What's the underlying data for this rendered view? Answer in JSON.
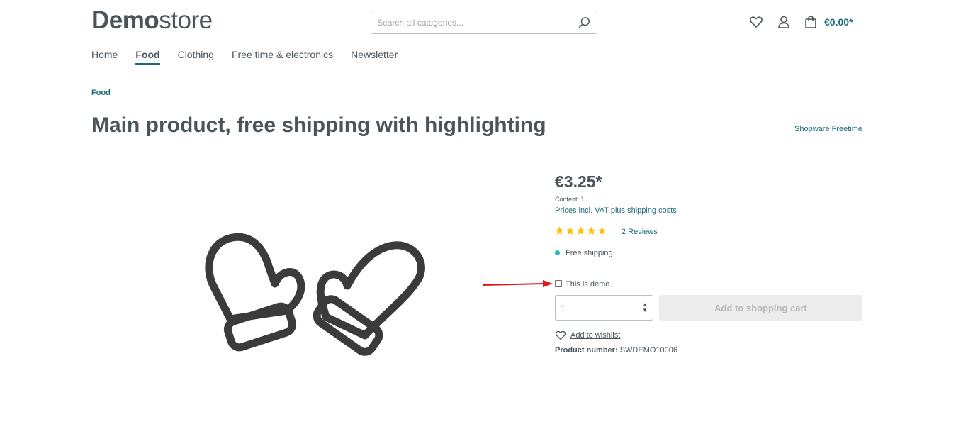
{
  "header": {
    "logo_bold": "Demo",
    "logo_light": "store",
    "search_placeholder": "Search all categories...",
    "cart_total": "€0.00*"
  },
  "nav": {
    "items": [
      "Home",
      "Food",
      "Clothing",
      "Free time & electronics",
      "Newsletter"
    ],
    "active": "Food"
  },
  "breadcrumb": "Food",
  "product": {
    "title": "Main product, free shipping with highlighting",
    "manufacturer": "Shopware Freetime",
    "price": "€3.25*",
    "content": "Content: 1",
    "tax_note": "Prices incl. VAT plus shipping costs",
    "rating_stars": 5,
    "reviews": "2 Reviews",
    "shipping": "Free shipping",
    "demo_checkbox_label": "This is demo.",
    "quantity": "1",
    "add_to_cart": "Add to shopping cart",
    "wishlist": "Add to wishlist",
    "number_label": "Product number:",
    "number_value": "SWDEMO10006"
  },
  "colors": {
    "accent": "#1f6c7a",
    "text": "#4a545b",
    "star": "#ffc107",
    "shipping_dot": "#2ab8c9",
    "annotation_arrow": "#e3141b"
  },
  "icons": [
    "search-icon",
    "heart-icon",
    "user-icon",
    "bag-icon",
    "star-icon",
    "mittens-icon",
    "arrow-annotation-icon"
  ]
}
